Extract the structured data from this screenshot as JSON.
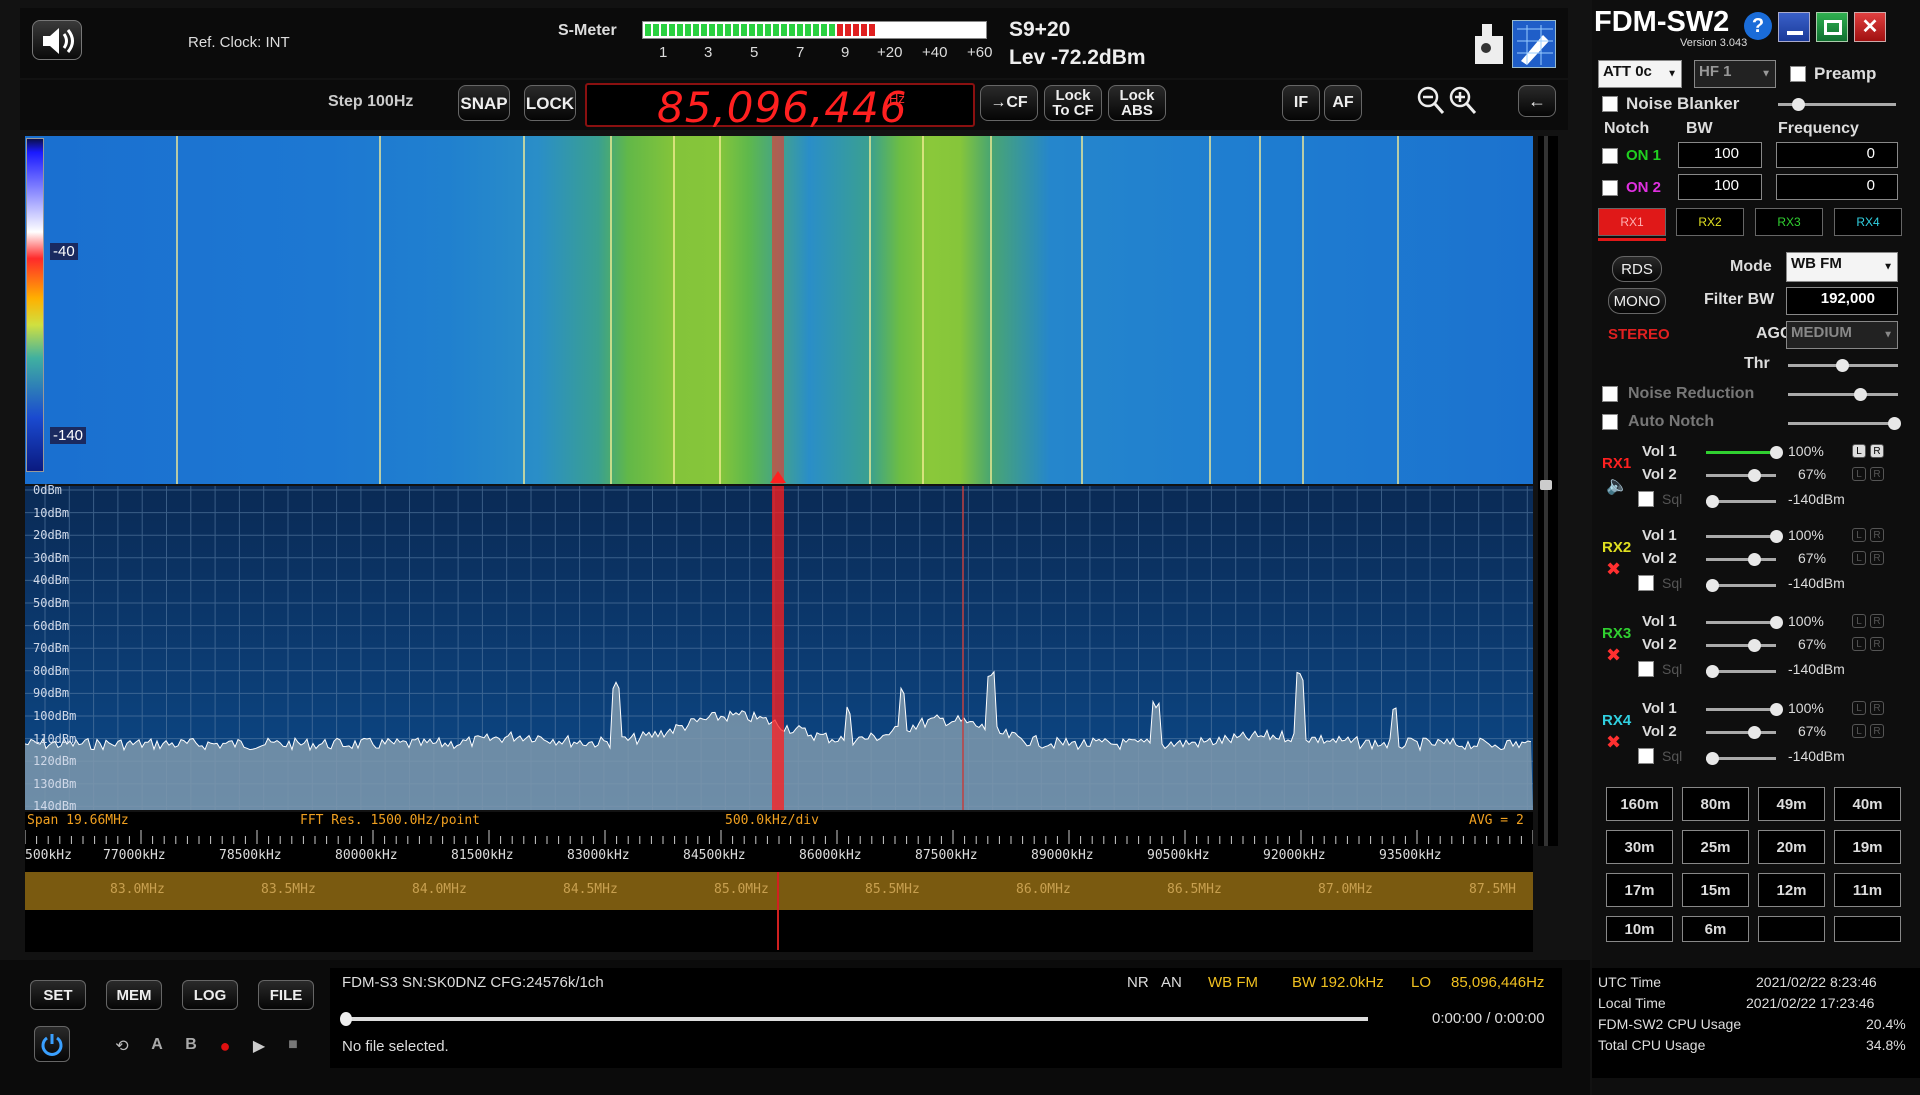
{
  "app": {
    "title": "FDM-SW2",
    "version": "Version 3.043"
  },
  "top": {
    "ref_clock": "Ref. Clock: INT",
    "smeter_label": "S-Meter",
    "smeter_scale": [
      "1",
      "3",
      "5",
      "7",
      "9",
      "+20",
      "+40",
      "+60"
    ],
    "smeter_reading": "S9+20",
    "level": "Lev -72.2dBm"
  },
  "controls": {
    "step": "Step 100Hz",
    "snap": "SNAP",
    "lock": "LOCK",
    "frequency": "85,096,446",
    "freq_unit": "Hz",
    "to_cf": "→CF",
    "lock_to_cf": "Lock To CF",
    "lock_abs": "Lock ABS",
    "if": "IF",
    "af": "AF"
  },
  "waterfall": {
    "scale_top": "-40",
    "scale_bottom": "-140"
  },
  "spectrum": {
    "dbm_labels": [
      "0dBm",
      "10dBm",
      "20dBm",
      "30dBm",
      "40dBm",
      "50dBm",
      "60dBm",
      "70dBm",
      "80dBm",
      "90dBm",
      "100dBm",
      "110dBm",
      "120dBm",
      "130dBm",
      "140dBm"
    ],
    "span": "Span 19.66MHz",
    "fft_res": "FFT Res. 1500.0Hz/point",
    "div": "500.0kHz/div",
    "avg": "AVG = 2",
    "khz_ticks": [
      "500kHz",
      "77000kHz",
      "78500kHz",
      "80000kHz",
      "81500kHz",
      "83000kHz",
      "84500kHz",
      "86000kHz",
      "87500kHz",
      "89000kHz",
      "90500kHz",
      "92000kHz",
      "93500kHz"
    ],
    "mhz_ticks": [
      "83.0MHz",
      "83.5MHz",
      "84.0MHz",
      "84.5MHz",
      "85.0MHz",
      "85.5MHz",
      "86.0MHz",
      "86.5MHz",
      "87.0MHz",
      "87.5MH"
    ]
  },
  "bottom": {
    "buttons": [
      "SET",
      "MEM",
      "LOG",
      "FILE"
    ],
    "player_icons": [
      "loop-icon",
      "a-marker-icon",
      "b-marker-icon",
      "record-icon",
      "play-icon",
      "stop-icon"
    ],
    "device": "FDM-S3 SN:SK0DNZ  CFG:24576k/1ch",
    "nr": "NR",
    "an": "AN",
    "mode": "WB FM",
    "bw": "BW 192.0kHz",
    "lo_label": "LO",
    "lo_value": "85,096,446Hz",
    "time": "0:00:00 / 0:00:00",
    "file": "No file selected."
  },
  "panel": {
    "att": "ATT 0c",
    "hf": "HF 1",
    "preamp": "Preamp",
    "noise_blanker": "Noise Blanker",
    "notch": "Notch",
    "bw_label": "BW",
    "freq_label": "Frequency",
    "on1": "ON 1",
    "on2": "ON 2",
    "notch1_bw": "100",
    "notch1_freq": "0",
    "notch2_bw": "100",
    "notch2_freq": "0",
    "rx_tabs": [
      "RX1",
      "RX2",
      "RX3",
      "RX4"
    ],
    "rds": "RDS",
    "mono": "MONO",
    "stereo": "STEREO",
    "mode_label": "Mode",
    "mode_value": "WB FM",
    "filter_label": "Filter BW",
    "filter_value": "192,000",
    "agc_label": "AGC",
    "agc_value": "MEDIUM",
    "thr_label": "Thr",
    "noise_reduction": "Noise Reduction",
    "auto_notch": "Auto Notch",
    "rx": [
      {
        "name": "RX1",
        "vol1": "100%",
        "vol2": "67%",
        "sql": "-140dBm"
      },
      {
        "name": "RX2",
        "vol1": "100%",
        "vol2": "67%",
        "sql": "-140dBm"
      },
      {
        "name": "RX3",
        "vol1": "100%",
        "vol2": "67%",
        "sql": "-140dBm"
      },
      {
        "name": "RX4",
        "vol1": "100%",
        "vol2": "67%",
        "sql": "-140dBm"
      }
    ],
    "vol1_label": "Vol 1",
    "vol2_label": "Vol 2",
    "sql_label": "Sql",
    "bands": [
      "160m",
      "80m",
      "49m",
      "40m",
      "30m",
      "25m",
      "20m",
      "19m",
      "17m",
      "15m",
      "12m",
      "11m",
      "10m",
      "6m",
      "",
      ""
    ],
    "utc_label": "UTC Time",
    "utc_value": "2021/02/22 8:23:46",
    "local_label": "Local Time",
    "local_value": "2021/02/22 17:23:46",
    "cpu_label": "FDM-SW2 CPU Usage",
    "cpu_value": "20.4%",
    "total_cpu_label": "Total CPU Usage",
    "total_cpu_value": "34.8%"
  },
  "colors": {
    "accent_red": "#ff2020",
    "rx1": "#ff2020",
    "rx2": "#e0e020",
    "rx3": "#30d030",
    "rx4": "#30d0e0"
  }
}
